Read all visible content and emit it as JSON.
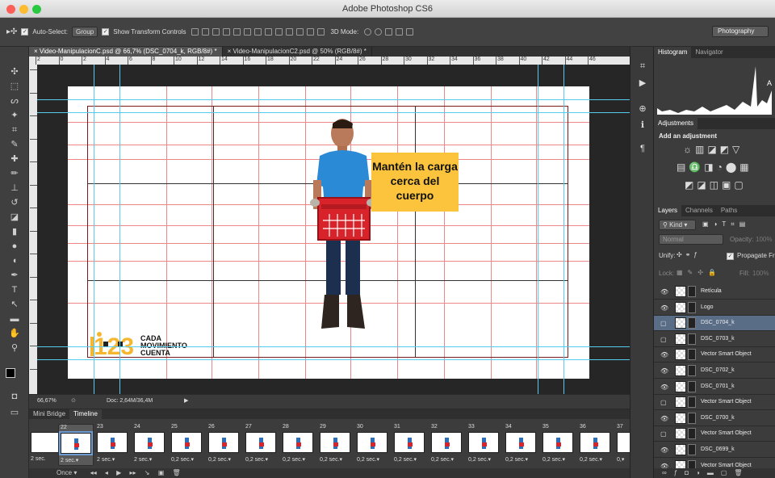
{
  "app": {
    "title": "Adobe Photoshop CS6"
  },
  "options": {
    "auto_select_label": "Auto-Select:",
    "auto_select_value": "Group",
    "transform_label": "Show Transform Controls",
    "mode_3d": "3D Mode:",
    "workspace": "Photography"
  },
  "tabs": [
    {
      "label": "Video-ManipulacionC.psd @ 66,7% (DSC_0704_k, RGB/8#) *"
    },
    {
      "label": "Video-ManipulacionC2.psd @ 50% (RGB/8#) *"
    }
  ],
  "ruler_labels": [
    "2",
    "0",
    "2",
    "4",
    "6",
    "8",
    "10",
    "12",
    "14",
    "16",
    "18",
    "20",
    "22",
    "24",
    "26",
    "28",
    "30",
    "32",
    "34",
    "36",
    "38",
    "40",
    "42",
    "44",
    "46"
  ],
  "canvas": {
    "callout": "Mantén la carga cerca del cuerpo",
    "logo_text": [
      "CADA",
      "MOVIMIENTO",
      "CUENTA"
    ]
  },
  "status": {
    "zoom": "66,67%",
    "doc": "Doc: 2,64M/36,4M"
  },
  "timeline": {
    "tabs": [
      "Mini Bridge",
      "Timeline"
    ],
    "loop": "Once",
    "frames": [
      {
        "num": "22",
        "dur": "2 sec."
      },
      {
        "num": "23",
        "dur": "2 sec."
      },
      {
        "num": "24",
        "dur": "2 sec."
      },
      {
        "num": "25",
        "dur": "0,2 sec."
      },
      {
        "num": "26",
        "dur": "0,2 sec."
      },
      {
        "num": "27",
        "dur": "0,2 sec."
      },
      {
        "num": "28",
        "dur": "0,2 sec."
      },
      {
        "num": "29",
        "dur": "0,2 sec."
      },
      {
        "num": "30",
        "dur": "0,2 sec."
      },
      {
        "num": "31",
        "dur": "0,2 sec."
      },
      {
        "num": "32",
        "dur": "0,2 sec."
      },
      {
        "num": "33",
        "dur": "0,2 sec."
      },
      {
        "num": "34",
        "dur": "0,2 sec."
      },
      {
        "num": "35",
        "dur": "0,2 sec."
      },
      {
        "num": "36",
        "dur": "0,2 sec."
      },
      {
        "num": "37",
        "dur": "0,"
      }
    ],
    "first_dur": "2 sec."
  },
  "panels": {
    "hist_tabs": [
      "Histogram",
      "Navigator"
    ],
    "adj_tab": "Adjustments",
    "adj_title": "Add an adjustment",
    "layer_tabs": [
      "Layers",
      "Channels",
      "Paths"
    ],
    "kind": "Kind",
    "blend": "Normal",
    "opacity": "Opacity:",
    "opacity_val": "100%",
    "unify": "Unify:",
    "propagate": "Propagate Frame",
    "lock": "Lock:",
    "fill": "Fill:",
    "fill_val": "100%",
    "layers": [
      {
        "name": "Retícula",
        "visible": true
      },
      {
        "name": "Logo",
        "visible": true
      },
      {
        "name": "DSC_0704_k",
        "visible": false,
        "active": true
      },
      {
        "name": "DSC_0703_k",
        "visible": false
      },
      {
        "name": "Vector Smart Object",
        "visible": true
      },
      {
        "name": "DSC_0702_k",
        "visible": true
      },
      {
        "name": "DSC_0701_k",
        "visible": true
      },
      {
        "name": "Vector Smart Object",
        "visible": false
      },
      {
        "name": "DSC_0700_k",
        "visible": true
      },
      {
        "name": "Vector Smart Object",
        "visible": false
      },
      {
        "name": "DSC_0699_k",
        "visible": true
      },
      {
        "name": "Vector Smart Object",
        "visible": true
      }
    ]
  }
}
